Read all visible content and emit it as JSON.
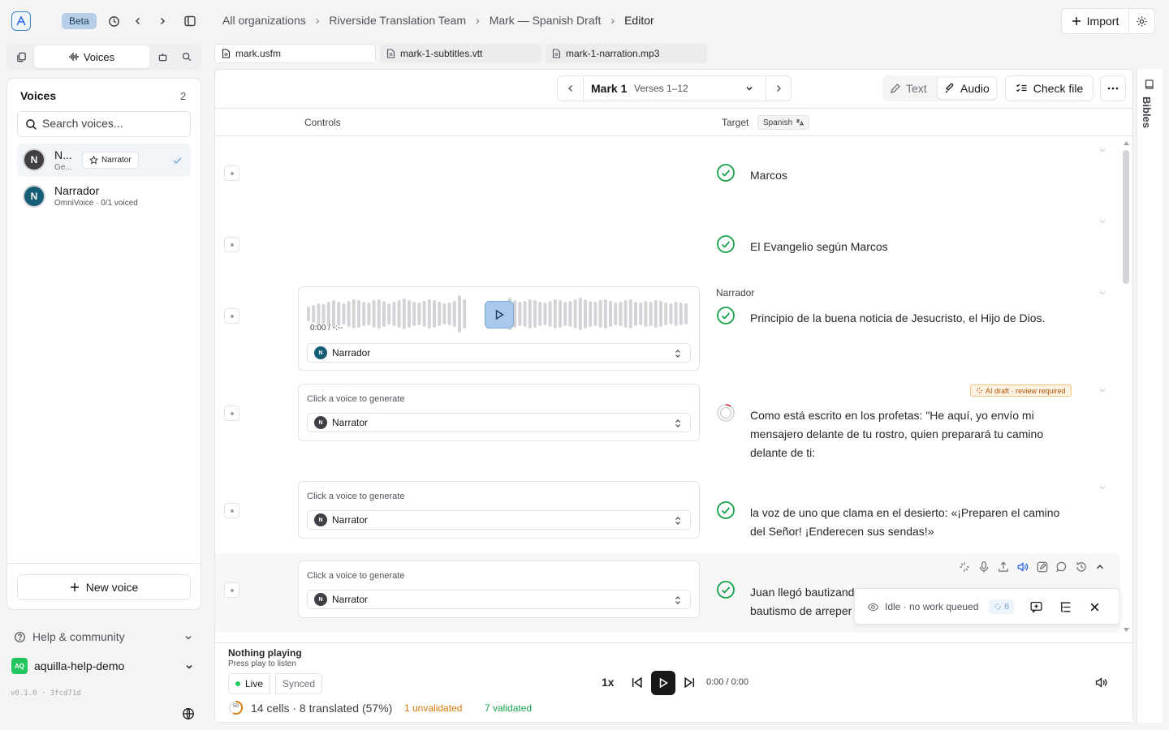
{
  "app": {
    "beta_label": "Beta"
  },
  "breadcrumb": [
    "All organizations",
    "Riverside Translation Team",
    "Mark — Spanish Draft",
    "Editor"
  ],
  "header": {
    "import_label": "Import"
  },
  "left_tabs": {
    "voices_label": "Voices"
  },
  "voices_panel": {
    "title": "Voices",
    "count": "2",
    "search_placeholder": "Search voices...",
    "voices": [
      {
        "initial": "N",
        "name": "N...",
        "meta": "Ge...",
        "tag": "Narrator",
        "selected": true
      },
      {
        "initial": "N",
        "name": "Narrador",
        "meta": "OmniVoice · 0/1 voiced",
        "selected": false
      }
    ],
    "new_voice_label": "New voice"
  },
  "sidebar_footer": {
    "help_label": "Help & community",
    "org_badge": "AQ",
    "org_name": "aquilla-help-demo",
    "version": "v0.1.0 · 3fcd71d"
  },
  "file_tabs": [
    "mark.usfm",
    "mark-1-subtitles.vtt",
    "mark-1-narration.mp3"
  ],
  "toolbar": {
    "book_chapter": "Mark 1",
    "verse_range": "Verses 1–12",
    "mode_text": "Text",
    "mode_audio": "Audio",
    "check_file": "Check file"
  },
  "columns": {
    "controls": "Controls",
    "target": "Target",
    "target_language": "Spanish"
  },
  "rows": [
    {
      "text": "Marcos",
      "status": "validated"
    },
    {
      "text": "El Evangelio según Marcos",
      "status": "validated"
    },
    {
      "speaker": "Narrador",
      "text": "Principio de la buena noticia de Jesucristo, el Hijo de Dios.",
      "status": "validated",
      "audio_time": "0:00 / -:--",
      "voice": "Narrador"
    },
    {
      "text": "Como está escrito en los profetas: \"He aquí, yo envío mi mensajero delante de tu rostro, quien preparará tu camino delante de ti:",
      "status": "pending",
      "badge": "AI draft · review required",
      "hint": "Click a voice to generate",
      "voice": "Narrator"
    },
    {
      "text": "la voz de uno que clama en el desierto: «¡Preparen el camino del Señor! ¡Enderecen sus sendas!»",
      "status": "validated",
      "hint": "Click a voice to generate",
      "voice": "Narrator"
    },
    {
      "text": "Juan llegó bautizando en el desierto y predicando el bautismo de arrepentimiento",
      "text_visible_l1": "Juan llegó bautizand",
      "text_visible_l2": "bautismo de arreper",
      "status": "validated",
      "hint": "Click a voice to generate",
      "voice": "Narrator"
    }
  ],
  "status_popover": {
    "text": "Idle · no work queued",
    "count": "6"
  },
  "bibles_label": "Bibles",
  "player": {
    "title": "Nothing playing",
    "subtitle": "Press play to listen",
    "mode_live": "Live",
    "mode_synced": "Synced",
    "speed": "1x",
    "time": "0:00 / 0:00"
  },
  "stats": {
    "progress_pct": 57,
    "progress_label": "50",
    "summary": "14 cells · 8 translated (57%)",
    "unvalidated": "1 unvalidated",
    "validated": "7 validated"
  },
  "colors": {
    "accent": "#2563eb",
    "validated": "#16a34a",
    "warning": "#d97706",
    "avatar_dark": "#3f3f46",
    "avatar_teal": "#155e75"
  }
}
